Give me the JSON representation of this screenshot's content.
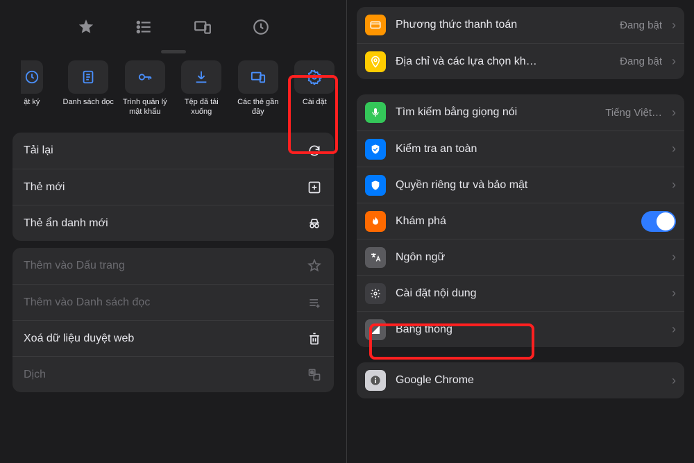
{
  "left": {
    "tabs": [
      "bookmarks",
      "reading-list",
      "tabs",
      "history"
    ],
    "actions": {
      "first_partial": {
        "label": "ật ký"
      },
      "items": [
        {
          "name": "reading-list",
          "label": "Danh sách đọc"
        },
        {
          "name": "password-mgr",
          "label": "Trình quản lý mật khẩu"
        },
        {
          "name": "downloads",
          "label": "Tệp đã tải xuống"
        },
        {
          "name": "recent-tabs",
          "label": "Các thẻ gần đây"
        },
        {
          "name": "settings",
          "label": "Cài đặt"
        }
      ]
    },
    "menu1": [
      {
        "name": "reload",
        "label": "Tải lại"
      },
      {
        "name": "new-tab",
        "label": "Thẻ mới"
      },
      {
        "name": "new-incognito",
        "label": "Thẻ ẩn danh mới"
      }
    ],
    "menu2": [
      {
        "name": "add-bookmark",
        "label": "Thêm vào Dấu trang",
        "disabled": true
      },
      {
        "name": "add-readinglist",
        "label": "Thêm vào Danh sách đọc",
        "disabled": true
      },
      {
        "name": "clear-data",
        "label": "Xoá dữ liệu duyệt web"
      },
      {
        "name": "translate",
        "label": "Dịch",
        "disabled": true
      }
    ]
  },
  "right": {
    "group1": [
      {
        "name": "payment",
        "label": "Phương thức thanh toán",
        "value": "Đang bật",
        "icon": "card",
        "color": "ai-orange"
      },
      {
        "name": "address",
        "label": "Địa chỉ và các lựa chọn kh…",
        "value": "Đang bật",
        "icon": "pin",
        "color": "ai-yellow"
      }
    ],
    "group2": [
      {
        "name": "voice-search",
        "label": "Tìm kiếm bằng giọng nói",
        "value": "Tiếng Việt…",
        "icon": "mic",
        "color": "ai-green"
      },
      {
        "name": "safety-check",
        "label": "Kiểm tra an toàn",
        "icon": "shield-check",
        "color": "ai-blue"
      },
      {
        "name": "privacy",
        "label": "Quyền riêng tư và bảo mật",
        "icon": "shield",
        "color": "ai-blue"
      },
      {
        "name": "discover",
        "label": "Khám phá",
        "icon": "flame",
        "color": "ai-orange2",
        "toggle": true
      },
      {
        "name": "language",
        "label": "Ngôn ngữ",
        "icon": "translate",
        "color": "ai-gray"
      },
      {
        "name": "content-settings",
        "label": "Cài đặt nội dung",
        "icon": "gear",
        "color": "ai-darkgray"
      },
      {
        "name": "bandwidth",
        "label": "Băng thông",
        "icon": "signal",
        "color": "ai-gray"
      }
    ],
    "group3": [
      {
        "name": "google-chrome",
        "label": "Google Chrome",
        "icon": "info",
        "color": "ai-light"
      }
    ]
  }
}
